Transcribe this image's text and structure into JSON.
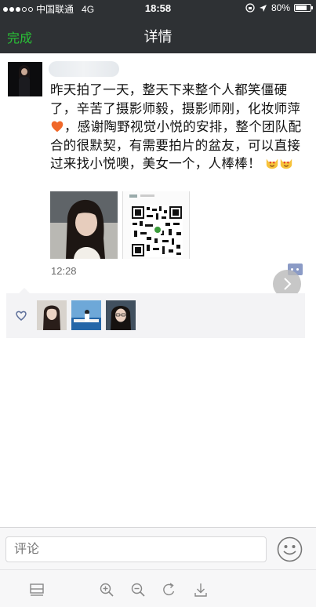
{
  "status_bar": {
    "carrier": "中国联通",
    "network": "4G",
    "time": "18:58",
    "battery_percent": "80%",
    "battery_level": 0.8,
    "signal_filled": 3,
    "signal_total": 5
  },
  "nav": {
    "done_label": "完成",
    "title": "详情"
  },
  "post": {
    "text": "昨天拍了一天，整天下来整个人都笑僵硬了，辛苦了摄影师毅，摄影师刚，化妆师萍",
    "text2": "，感谢陶野视觉小悦的安排，整个团队配合的很默契，有需要拍片的盆友，可以直接过来找小悦噢，美女一个，人棒棒！",
    "time": "12:28",
    "images": [
      "portrait-photo",
      "qr-code-image"
    ]
  },
  "likes": {
    "icon": "heart-outline-icon",
    "avatars": [
      "liker-avatar-1",
      "liker-avatar-2",
      "liker-avatar-3"
    ]
  },
  "comment_bar": {
    "placeholder": "评论"
  },
  "colors": {
    "nav_bg": "#2e3134",
    "done_green": "#29c036",
    "like_box_bg": "#f3f3f5"
  }
}
